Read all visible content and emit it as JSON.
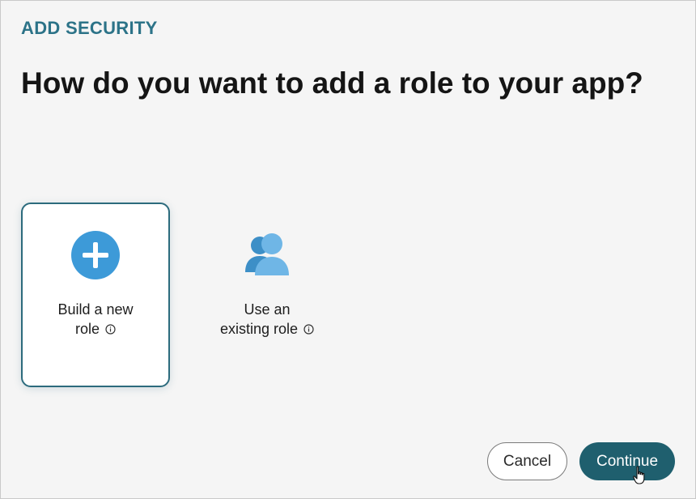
{
  "dialog": {
    "eyebrow": "ADD SECURITY",
    "title": "How do you want to add a role to your app?"
  },
  "options": [
    {
      "id": "build-new-role",
      "label_line1": "Build a new",
      "label_line2": "role",
      "icon": "plus-circle-icon",
      "selected": true
    },
    {
      "id": "use-existing-role",
      "label_line1": "Use an",
      "label_line2": "existing role",
      "icon": "users-icon",
      "selected": false
    }
  ],
  "buttons": {
    "cancel": "Cancel",
    "continue": "Continue"
  },
  "colors": {
    "accent": "#2c7388",
    "primary_button": "#1f5f6e",
    "selected_border": "#2c6b7d",
    "icon_blue": "#3d9ad8"
  }
}
